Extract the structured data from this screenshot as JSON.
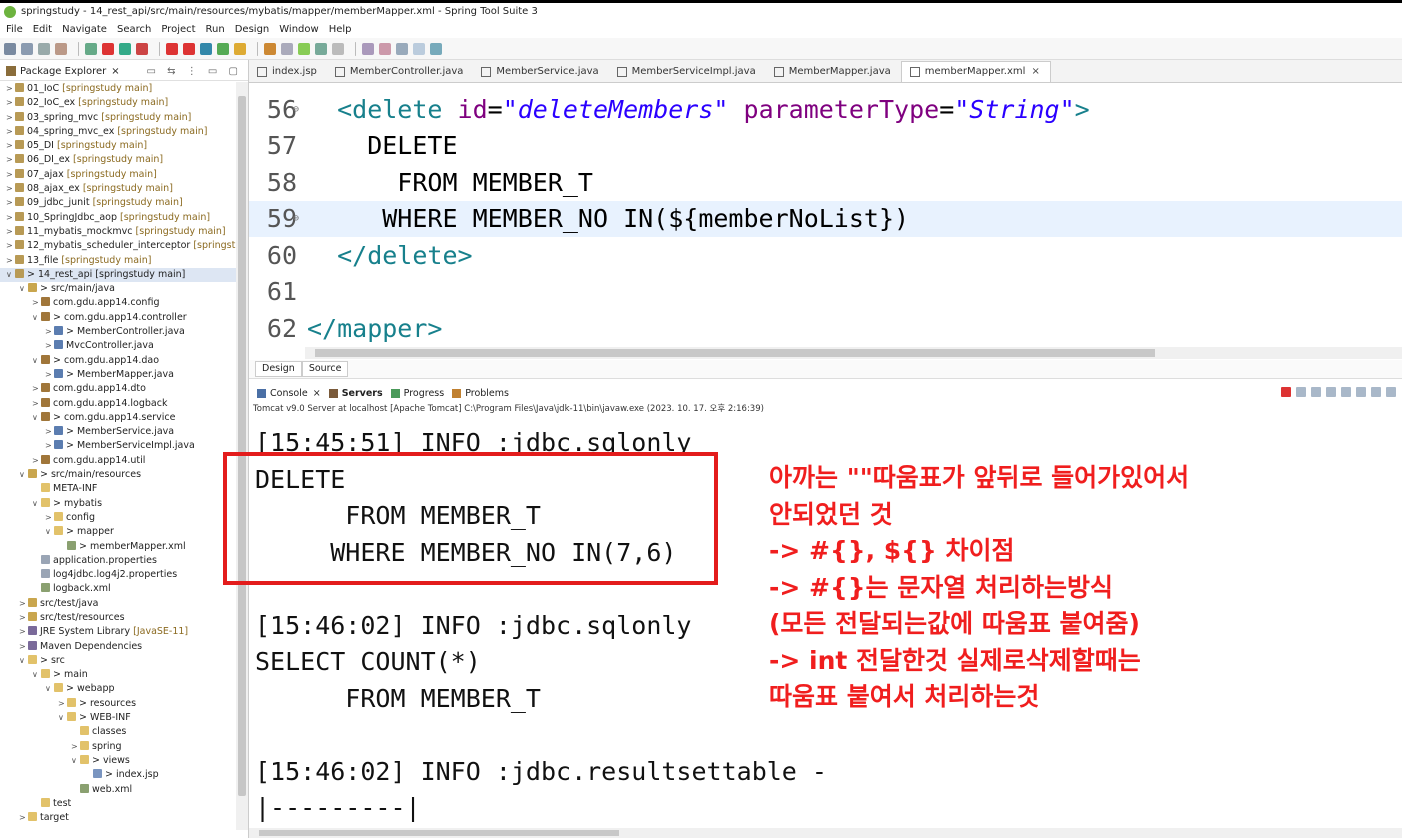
{
  "window": {
    "title": "springstudy - 14_rest_api/src/main/resources/mybatis/mapper/memberMapper.xml - Spring Tool Suite 3"
  },
  "menu": [
    "File",
    "Edit",
    "Navigate",
    "Search",
    "Project",
    "Run",
    "Design",
    "Window",
    "Help"
  ],
  "package_explorer": {
    "title": "Package Explorer",
    "rows": [
      {
        "indent": 0,
        "arrow": ">",
        "label": "01_IoC",
        "decoration": " [springstudy main]",
        "icon": "project-icon"
      },
      {
        "indent": 0,
        "arrow": ">",
        "label": "02_IoC_ex",
        "decoration": " [springstudy main]",
        "icon": "project-icon"
      },
      {
        "indent": 0,
        "arrow": ">",
        "label": "03_spring_mvc",
        "decoration": " [springstudy main]",
        "icon": "project-icon"
      },
      {
        "indent": 0,
        "arrow": ">",
        "label": "04_spring_mvc_ex",
        "decoration": " [springstudy main]",
        "icon": "project-icon"
      },
      {
        "indent": 0,
        "arrow": ">",
        "label": "05_DI",
        "decoration": " [springstudy main]",
        "icon": "project-icon"
      },
      {
        "indent": 0,
        "arrow": ">",
        "label": "06_DI_ex",
        "decoration": " [springstudy main]",
        "icon": "project-icon"
      },
      {
        "indent": 0,
        "arrow": ">",
        "label": "07_ajax",
        "decoration": " [springstudy main]",
        "icon": "project-icon"
      },
      {
        "indent": 0,
        "arrow": ">",
        "label": "08_ajax_ex",
        "decoration": " [springstudy main]",
        "icon": "project-icon"
      },
      {
        "indent": 0,
        "arrow": ">",
        "label": "09_jdbc_junit",
        "decoration": " [springstudy main]",
        "icon": "project-icon"
      },
      {
        "indent": 0,
        "arrow": ">",
        "label": "10_SpringJdbc_aop",
        "decoration": " [springstudy main]",
        "icon": "project-icon"
      },
      {
        "indent": 0,
        "arrow": ">",
        "label": "11_mybatis_mockmvc",
        "decoration": " [springstudy main]",
        "icon": "project-icon"
      },
      {
        "indent": 0,
        "arrow": ">",
        "label": "12_mybatis_scheduler_interceptor",
        "decoration": " [springstudy",
        "icon": "project-icon"
      },
      {
        "indent": 0,
        "arrow": ">",
        "label": "13_file",
        "decoration": " [springstudy main]",
        "icon": "project-icon"
      },
      {
        "indent": 0,
        "arrow": "v",
        "label": "> 14_rest_api [springstudy main]",
        "decoration": "",
        "icon": "project-icon",
        "selected": true
      },
      {
        "indent": 1,
        "arrow": "v",
        "label": "> src/main/java",
        "decoration": "",
        "icon": "source-folder-icon"
      },
      {
        "indent": 2,
        "arrow": ">",
        "label": "com.gdu.app14.config",
        "decoration": "",
        "icon": "package-icon"
      },
      {
        "indent": 2,
        "arrow": "v",
        "label": "> com.gdu.app14.controller",
        "decoration": "",
        "icon": "package-icon"
      },
      {
        "indent": 3,
        "arrow": ">",
        "label": "> MemberController.java",
        "decoration": "",
        "icon": "java-file-icon"
      },
      {
        "indent": 3,
        "arrow": ">",
        "label": "MvcController.java",
        "decoration": "",
        "icon": "java-file-icon"
      },
      {
        "indent": 2,
        "arrow": "v",
        "label": "> com.gdu.app14.dao",
        "decoration": "",
        "icon": "package-icon"
      },
      {
        "indent": 3,
        "arrow": ">",
        "label": "> MemberMapper.java",
        "decoration": "",
        "icon": "java-file-icon"
      },
      {
        "indent": 2,
        "arrow": ">",
        "label": "com.gdu.app14.dto",
        "decoration": "",
        "icon": "package-icon"
      },
      {
        "indent": 2,
        "arrow": ">",
        "label": "com.gdu.app14.logback",
        "decoration": "",
        "icon": "package-icon"
      },
      {
        "indent": 2,
        "arrow": "v",
        "label": "> com.gdu.app14.service",
        "decoration": "",
        "icon": "package-icon"
      },
      {
        "indent": 3,
        "arrow": ">",
        "label": "> MemberService.java",
        "decoration": "",
        "icon": "java-file-icon"
      },
      {
        "indent": 3,
        "arrow": ">",
        "label": "> MemberServiceImpl.java",
        "decoration": "",
        "icon": "java-file-icon"
      },
      {
        "indent": 2,
        "arrow": ">",
        "label": "com.gdu.app14.util",
        "decoration": "",
        "icon": "package-icon"
      },
      {
        "indent": 1,
        "arrow": "v",
        "label": "> src/main/resources",
        "decoration": "",
        "icon": "source-folder-icon"
      },
      {
        "indent": 2,
        "arrow": "",
        "label": "META-INF",
        "decoration": "",
        "icon": "folder-icon"
      },
      {
        "indent": 2,
        "arrow": "v",
        "label": "> mybatis",
        "decoration": "",
        "icon": "folder-icon"
      },
      {
        "indent": 3,
        "arrow": ">",
        "label": "config",
        "decoration": "",
        "icon": "folder-icon"
      },
      {
        "indent": 3,
        "arrow": "v",
        "label": "> mapper",
        "decoration": "",
        "icon": "folder-icon"
      },
      {
        "indent": 4,
        "arrow": "",
        "label": "> memberMapper.xml",
        "decoration": "",
        "icon": "xml-file-icon"
      },
      {
        "indent": 2,
        "arrow": "",
        "label": "application.properties",
        "decoration": "",
        "icon": "properties-file-icon"
      },
      {
        "indent": 2,
        "arrow": "",
        "label": "log4jdbc.log4j2.properties",
        "decoration": "",
        "icon": "properties-file-icon"
      },
      {
        "indent": 2,
        "arrow": "",
        "label": "logback.xml",
        "decoration": "",
        "icon": "xml-file-icon"
      },
      {
        "indent": 1,
        "arrow": ">",
        "label": "src/test/java",
        "decoration": "",
        "icon": "source-folder-icon"
      },
      {
        "indent": 1,
        "arrow": ">",
        "label": "src/test/resources",
        "decoration": "",
        "icon": "source-folder-icon"
      },
      {
        "indent": 1,
        "arrow": ">",
        "label": "JRE System Library",
        "decoration": " [JavaSE-11]",
        "icon": "library-icon"
      },
      {
        "indent": 1,
        "arrow": ">",
        "label": "Maven Dependencies",
        "decoration": "",
        "icon": "library-icon"
      },
      {
        "indent": 1,
        "arrow": "v",
        "label": "> src",
        "decoration": "",
        "icon": "folder-icon"
      },
      {
        "indent": 2,
        "arrow": "v",
        "label": "> main",
        "decoration": "",
        "icon": "folder-icon"
      },
      {
        "indent": 3,
        "arrow": "v",
        "label": "> webapp",
        "decoration": "",
        "icon": "folder-icon"
      },
      {
        "indent": 4,
        "arrow": ">",
        "label": "> resources",
        "decoration": "",
        "icon": "folder-icon"
      },
      {
        "indent": 4,
        "arrow": "v",
        "label": "> WEB-INF",
        "decoration": "",
        "icon": "folder-icon"
      },
      {
        "indent": 5,
        "arrow": "",
        "label": "classes",
        "decoration": "",
        "icon": "folder-icon"
      },
      {
        "indent": 5,
        "arrow": ">",
        "label": "spring",
        "decoration": "",
        "icon": "folder-icon"
      },
      {
        "indent": 5,
        "arrow": "v",
        "label": "> views",
        "decoration": "",
        "icon": "folder-icon"
      },
      {
        "indent": 6,
        "arrow": "",
        "label": "> index.jsp",
        "decoration": "",
        "icon": "jsp-file-icon"
      },
      {
        "indent": 5,
        "arrow": "",
        "label": "web.xml",
        "decoration": "",
        "icon": "xml-file-icon"
      },
      {
        "indent": 2,
        "arrow": "",
        "label": "test",
        "decoration": "",
        "icon": "folder-icon"
      },
      {
        "indent": 1,
        "arrow": ">",
        "label": "target",
        "decoration": "",
        "icon": "folder-icon"
      }
    ]
  },
  "editor_tabs": [
    {
      "label": "index.jsp",
      "active": false
    },
    {
      "label": "MemberController.java",
      "active": false
    },
    {
      "label": "MemberService.java",
      "active": false
    },
    {
      "label": "MemberServiceImpl.java",
      "active": false
    },
    {
      "label": "MemberMapper.java",
      "active": false
    },
    {
      "label": "memberMapper.xml",
      "active": true
    }
  ],
  "editor": {
    "lines": [
      {
        "num": "56",
        "fold": "⊖",
        "current": false,
        "parts": [
          {
            "c": "kw-tag",
            "t": "  <delete "
          },
          {
            "c": "kw-attr",
            "t": "id"
          },
          {
            "c": "kw-txt",
            "t": "="
          },
          {
            "c": "kw-str",
            "t": "\"deleteMembers\""
          },
          {
            "c": "kw-attr",
            "t": " parameterType"
          },
          {
            "c": "kw-txt",
            "t": "="
          },
          {
            "c": "kw-str",
            "t": "\"String\""
          },
          {
            "c": "kw-tag",
            "t": ">"
          }
        ]
      },
      {
        "num": "57",
        "fold": "",
        "current": false,
        "parts": [
          {
            "c": "kw-txt",
            "t": "    DELETE"
          }
        ]
      },
      {
        "num": "58",
        "fold": "",
        "current": false,
        "parts": [
          {
            "c": "kw-txt",
            "t": "      FROM MEMBER_T"
          }
        ]
      },
      {
        "num": "59",
        "fold": "⊖",
        "current": true,
        "parts": [
          {
            "c": "kw-txt",
            "t": "     WHERE MEMBER_NO IN(${memberNoList})"
          }
        ]
      },
      {
        "num": "60",
        "fold": "",
        "current": false,
        "parts": [
          {
            "c": "kw-tag",
            "t": "  </delete>"
          }
        ]
      },
      {
        "num": "61",
        "fold": "",
        "current": false,
        "parts": []
      },
      {
        "num": "62",
        "fold": "",
        "current": false,
        "parts": [
          {
            "c": "kw-tag",
            "t": "</mapper>"
          }
        ]
      }
    ],
    "design_tab": "Design",
    "source_tab": "Source"
  },
  "console": {
    "tabs": [
      {
        "label": "Console",
        "icon": "console-icon",
        "close": true
      },
      {
        "label": "Servers",
        "icon": "servers-icon",
        "close": false
      },
      {
        "label": "Progress",
        "icon": "progress-icon",
        "close": false
      },
      {
        "label": "Problems",
        "icon": "problems-icon",
        "close": false
      }
    ],
    "launch_path": "Tomcat v9.0 Server at localhost [Apache Tomcat] C:\\Program Files\\Java\\jdk-11\\bin\\javaw.exe  (2023. 10. 17. 오후 2:16:39)",
    "lines": [
      "[15:45:51] INFO :jdbc.sqlonly",
      "DELETE",
      "      FROM MEMBER_T",
      "     WHERE MEMBER_NO IN(7,6)",
      "",
      "[15:46:02] INFO :jdbc.sqlonly",
      "SELECT COUNT(*)",
      "      FROM MEMBER_T",
      "",
      "[15:46:02] INFO :jdbc.resultsettable -",
      "|---------|"
    ]
  },
  "annotation": {
    "color": "#f01e1e",
    "lines": [
      "아까는 \"\"따움표가 앞뒤로 들어가있어서",
      "안되었던 것",
      "-> #{}, ${} 차이점",
      "-> #{}는 문자열 처리하는방식",
      "(모든 전달되는값에 따움표 붙여줌)",
      "-> int 전달한것 실제로삭제할때는",
      "따움표 붙여서 처리하는것"
    ]
  }
}
